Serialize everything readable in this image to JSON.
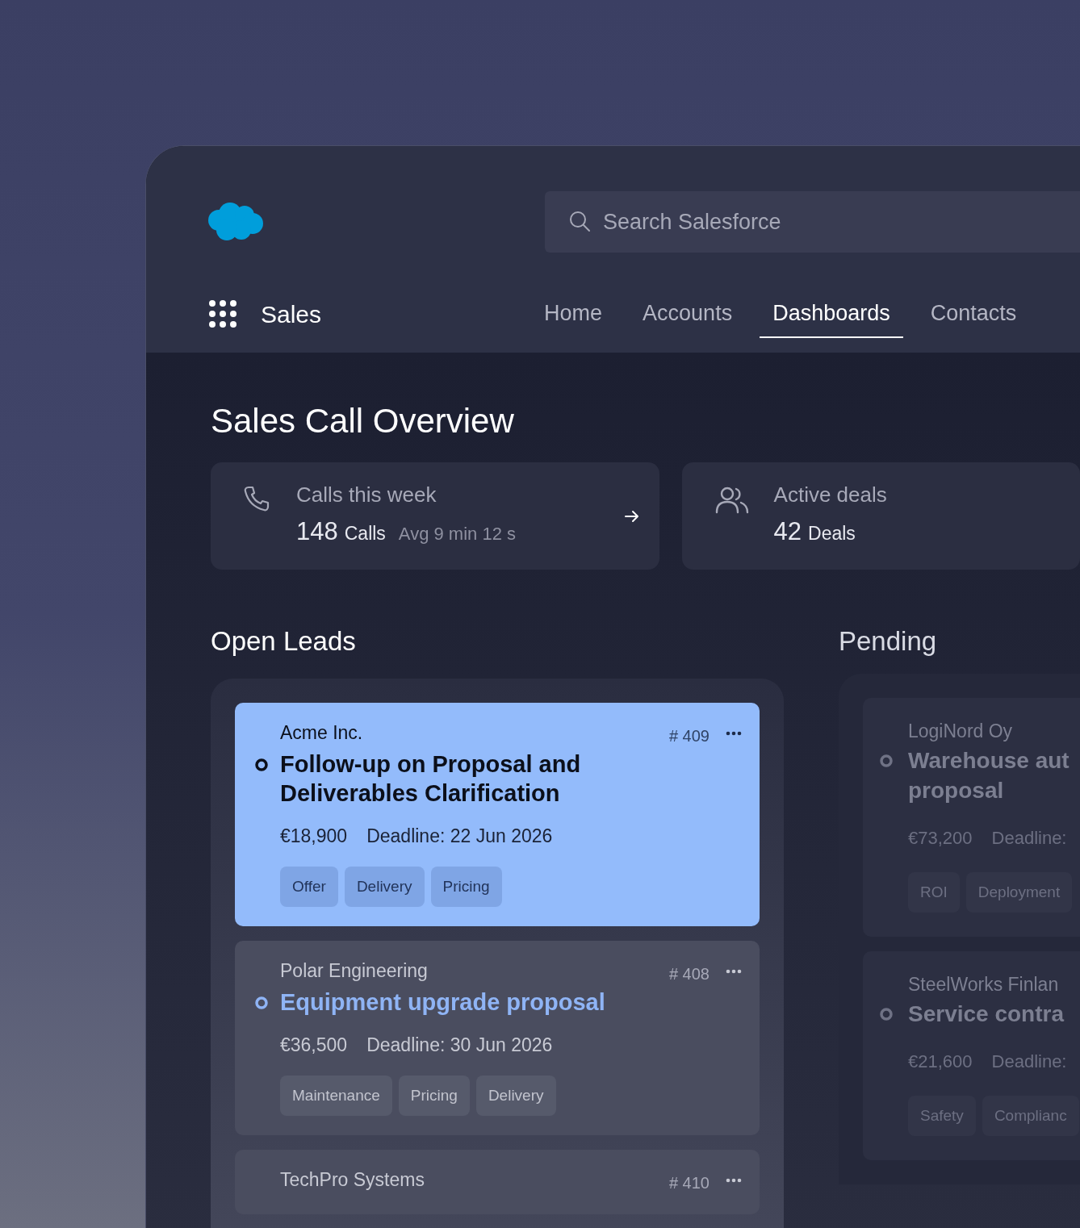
{
  "header": {
    "search": {
      "placeholder": "Search Salesforce"
    },
    "app_name": "Sales",
    "tabs": [
      {
        "label": "Home",
        "selected": false
      },
      {
        "label": "Accounts",
        "selected": false
      },
      {
        "label": "Dashboards",
        "selected": true
      },
      {
        "label": "Contacts",
        "selected": false
      }
    ]
  },
  "page": {
    "title": "Sales Call Overview"
  },
  "stats": [
    {
      "kind": "calls",
      "label": "Calls this week",
      "value": "148",
      "unit": "Calls",
      "detail": "Avg 9 min 12 s",
      "link": true
    },
    {
      "kind": "deals",
      "label": "Active deals",
      "value": "42",
      "unit": "Deals"
    }
  ],
  "open_leads": {
    "title": "Open Leads",
    "items": [
      {
        "company": "Acme Inc.",
        "number": "# 409",
        "title": "Follow-up on Proposal and Deliverables Clarification",
        "amount": "€18,900",
        "deadline": "Deadline: 22 Jun 2026",
        "tags": [
          "Offer",
          "Delivery",
          "Pricing"
        ],
        "selected": true
      },
      {
        "company": "Polar Engineering",
        "number": "# 408",
        "title": "Equipment upgrade proposal",
        "amount": "€36,500",
        "deadline": "Deadline: 30 Jun 2026",
        "tags": [
          "Maintenance",
          "Pricing",
          "Delivery"
        ],
        "selected": false
      },
      {
        "company": "TechPro Systems",
        "number": "# 410",
        "selected": false
      }
    ]
  },
  "pending": {
    "title": "Pending",
    "items": [
      {
        "company": "LogiNord Oy",
        "title_lines": [
          "Warehouse aut",
          "proposal"
        ],
        "amount": "€73,200",
        "deadline": "Deadline:",
        "tags": [
          "ROI",
          "Deployment"
        ]
      },
      {
        "company": "SteelWorks Finlan",
        "title_lines": [
          "Service contra"
        ],
        "amount": "€21,600",
        "deadline": "Deadline:",
        "tags": [
          "Safety",
          "Complianc"
        ]
      }
    ]
  }
}
